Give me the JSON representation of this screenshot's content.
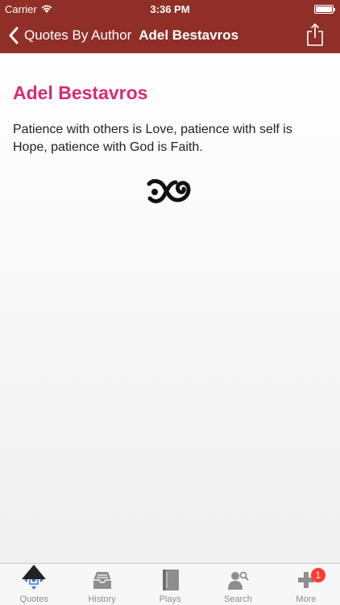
{
  "status": {
    "carrier": "Carrier",
    "time": "3:36 PM"
  },
  "nav": {
    "back_label": "Quotes By Author",
    "title": "Adel Bestavros"
  },
  "quote": {
    "author": "Adel Bestavros",
    "text": "Patience with others is Love, patience with self is Hope, patience with God is Faith."
  },
  "tabs": [
    {
      "label": "Quotes",
      "icon": "quotes-icon"
    },
    {
      "label": "History",
      "icon": "history-icon"
    },
    {
      "label": "Plays",
      "icon": "plays-icon"
    },
    {
      "label": "Search",
      "icon": "search-icon"
    },
    {
      "label": "More",
      "icon": "more-icon",
      "badge": "1"
    }
  ],
  "colors": {
    "navbar": "#8f2f28",
    "author": "#d72b73",
    "badge": "#ff3b30",
    "active_tab": "#3a73d6"
  }
}
